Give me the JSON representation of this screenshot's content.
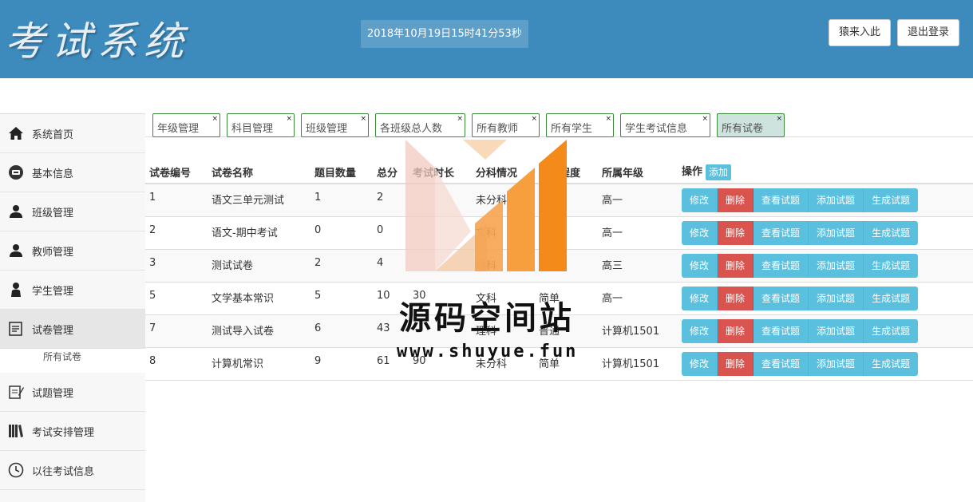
{
  "header": {
    "logo": "考试系统",
    "clock": "2018年10月19日15时41分53秒",
    "guess_button": "猿来入此",
    "logout_button": "退出登录"
  },
  "sidebar": {
    "items": [
      {
        "label": "系统首页",
        "icon": "home-icon"
      },
      {
        "label": "基本信息",
        "icon": "info-icon"
      },
      {
        "label": "班级管理",
        "icon": "user-icon"
      },
      {
        "label": "教师管理",
        "icon": "user-icon"
      },
      {
        "label": "学生管理",
        "icon": "person-icon"
      },
      {
        "label": "试卷管理",
        "icon": "edit-icon"
      },
      {
        "label": "试题管理",
        "icon": "pen-icon"
      },
      {
        "label": "考试安排管理",
        "icon": "books-icon"
      },
      {
        "label": "以往考试信息",
        "icon": "clock-icon"
      }
    ],
    "sub_item": "所有试卷"
  },
  "tabs": [
    {
      "label": "年级管理"
    },
    {
      "label": "科目管理"
    },
    {
      "label": "班级管理"
    },
    {
      "label": "各班级总人数"
    },
    {
      "label": "所有教师"
    },
    {
      "label": "所有学生"
    },
    {
      "label": "学生考试信息"
    },
    {
      "label": "所有试卷"
    }
  ],
  "tab_close": "×",
  "table": {
    "headers": [
      "试卷编号",
      "试卷名称",
      "题目数量",
      "总分",
      "考试时长",
      "分科情况",
      "难易程度",
      "所属年级",
      "操作"
    ],
    "add_label": "添加",
    "rows": [
      [
        "1",
        "语文三单元测试",
        "1",
        "2",
        "",
        "未分科",
        "",
        "高一"
      ],
      [
        "2",
        "语文-期中考试",
        "0",
        "0",
        "",
        "文科",
        "",
        "高一"
      ],
      [
        "3",
        "测试试卷",
        "2",
        "4",
        "",
        "理科",
        "简",
        "高三"
      ],
      [
        "5",
        "文学基本常识",
        "5",
        "10",
        "30",
        "文科",
        "简单",
        "高一"
      ],
      [
        "7",
        "测试导入试卷",
        "6",
        "43",
        "",
        "理科",
        "普通",
        "计算机1501"
      ],
      [
        "8",
        "计算机常识",
        "9",
        "61",
        "90",
        "未分科",
        "简单",
        "计算机1501"
      ]
    ],
    "ops": [
      "修改",
      "删除",
      "查看试题",
      "添加试题",
      "生成试题"
    ]
  },
  "watermark": {
    "text": "源码空间站",
    "url": "www.shuyue.fun"
  },
  "colors": {
    "header": "#3d8bbd",
    "info": "#5bc0de",
    "danger": "#d9534f",
    "tab_border": "#3a8a3a"
  }
}
